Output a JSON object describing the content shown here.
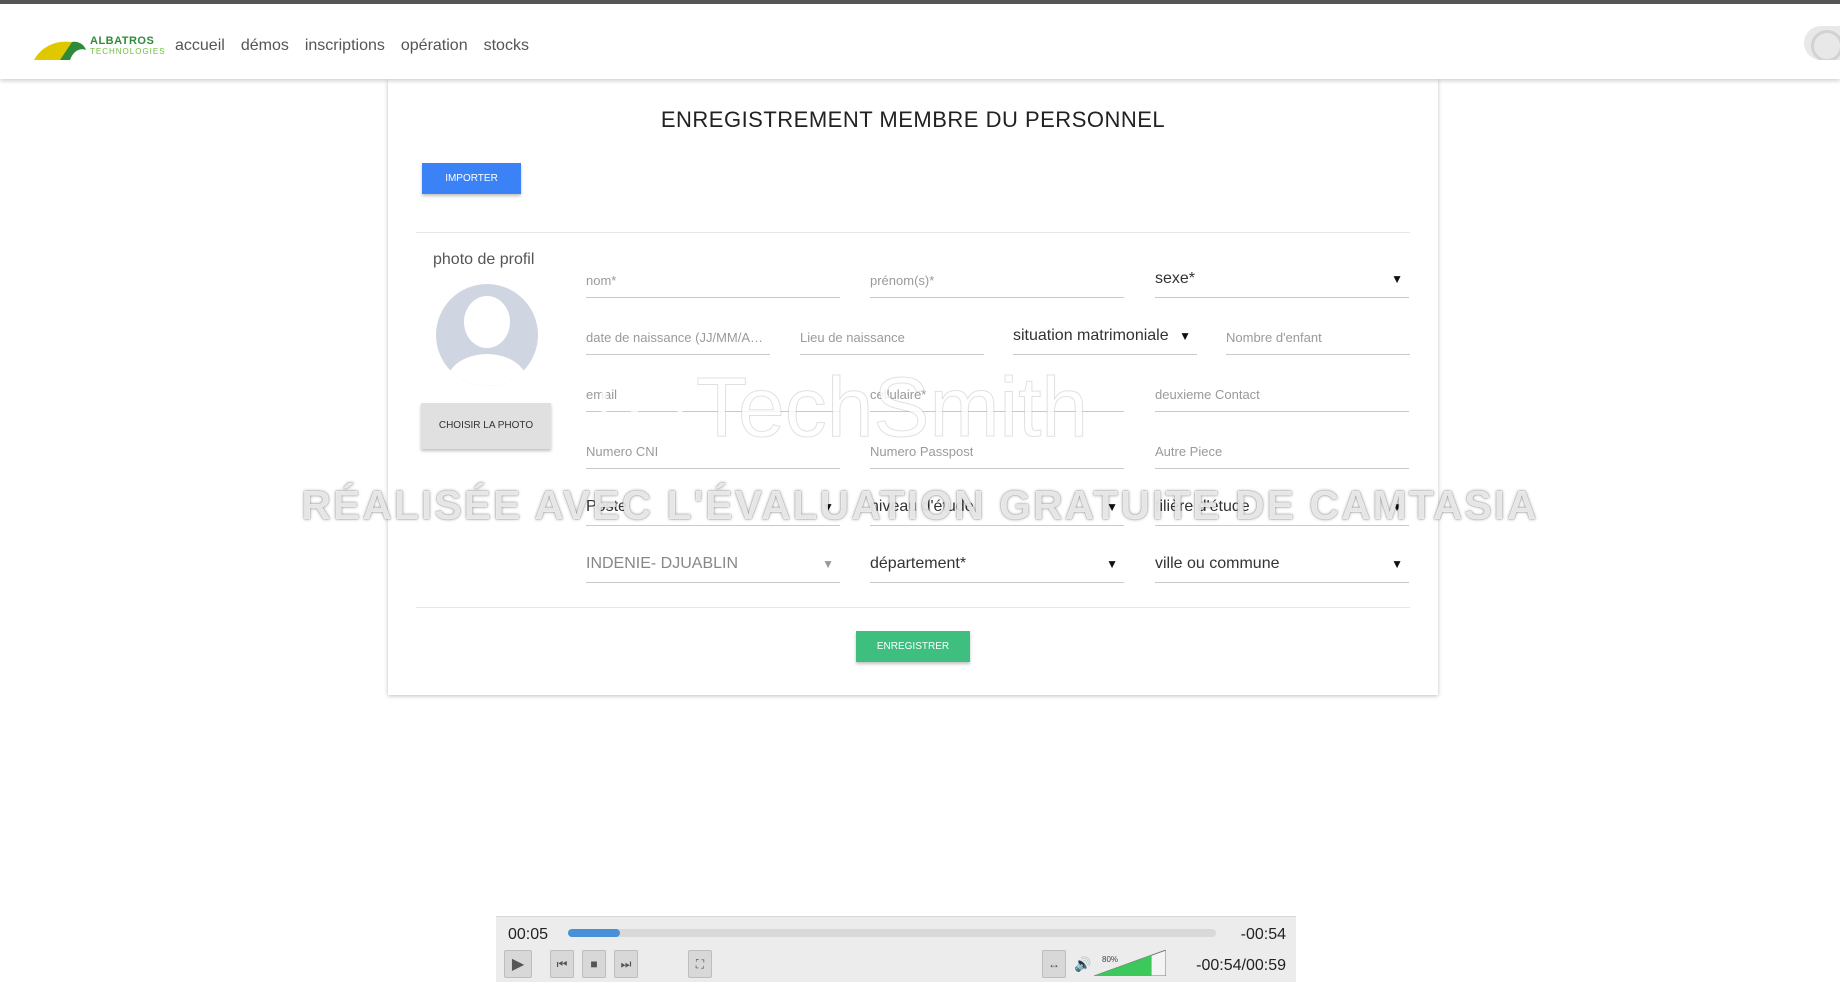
{
  "header": {
    "logo_name": "ALBATROS",
    "logo_sub": "TECHNOLOGIES",
    "nav": [
      "accueil",
      "démos",
      "inscriptions",
      "opération",
      "stocks"
    ]
  },
  "form": {
    "title": "ENREGISTREMENT MEMBRE DU PERSONNEL",
    "import_label": "IMPORTER",
    "photo_label": "photo de profil",
    "choose_photo_label": "CHOISIR LA PHOTO",
    "fields": {
      "nom": "nom*",
      "prenom": "prénom(s)*",
      "sexe": "sexe*",
      "date_naissance": "date de naissance (JJ/MM/AAAA)",
      "lieu_naissance": "Lieu de naissance",
      "situation": "situation matrimoniale",
      "nombre_enfant": "Nombre d'enfant",
      "email": "email",
      "cellulaire": "cellulaire*",
      "deuxieme_contact": "deuxieme Contact",
      "cni": "Numero CNI",
      "passport": "Numero Passpost",
      "autre_piece": "Autre Piece",
      "poste": "Poste",
      "niveau": "niveau d'étude",
      "filiere": "filière d'étude",
      "region": "INDENIE- DJUABLIN",
      "departement": "département*",
      "ville": "ville ou commune"
    },
    "save_label": "ENREGISTRER"
  },
  "watermark": {
    "brand": "TechSmith",
    "text": "RÉALISÉE AVEC L'ÉVALUATION GRATUITE DE CAMTASIA"
  },
  "player": {
    "elapsed": "00:05",
    "remaining": "-00:54",
    "progress_fraction": 0.08,
    "volume": "80%",
    "volume_fraction": 0.8,
    "position_total": "-00:54/00:59"
  },
  "colors": {
    "primary": "#3b82f6",
    "success": "#3fbf7f",
    "logo_green": "#2e8b3a",
    "logo_yellow": "#e0c800"
  }
}
